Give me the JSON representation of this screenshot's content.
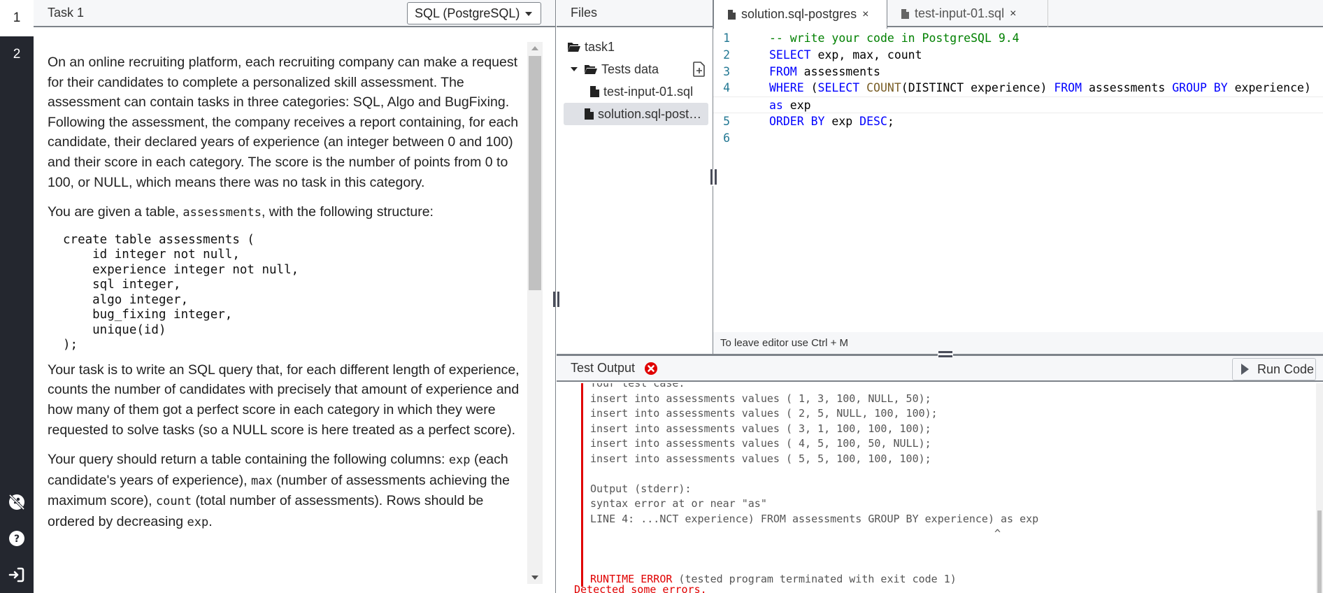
{
  "nav": {
    "tasks": [
      {
        "label": "1",
        "active": true
      },
      {
        "label": "2",
        "active": false
      }
    ],
    "bottom_icons": [
      "accessibility-off-icon",
      "help-icon",
      "sign-out-icon"
    ]
  },
  "task": {
    "title": "Task 1",
    "language": "SQL (PostgreSQL)",
    "para1": "On an online recruiting platform, each recruiting company can make a request for their candidates to complete a personalized skill assessment. The assessment can contain tasks in three categories: SQL, Algo and BugFixing. Following the assessment, the company receives a report containing, for each candidate, their declared years of experience (an integer between 0 and 100) and their score in each category. The score is the number of points from 0 to 100, or NULL, which means there was no task in this category.",
    "para2_before": "You are given a table, ",
    "para2_code": "assessments",
    "para2_after": ", with the following structure:",
    "schema": "create table assessments (\n    id integer not null,\n    experience integer not null,\n    sql integer,\n    algo integer,\n    bug_fixing integer,\n    unique(id)\n);",
    "para3": "Your task is to write an SQL query that, for each different length of experience, counts the number of candidates with precisely that amount of experience and how many of them got a perfect score in each category in which they were requested to solve tasks (so a NULL score is here treated as a perfect score).",
    "para4": {
      "t1": "Your query should return a table containing the following columns: ",
      "c1": "exp",
      "t2": " (each candidate's years of experience), ",
      "c2": "max",
      "t3": " (number of assessments achieving the maximum score), ",
      "c3": "count",
      "t4": " (total number of assessments). Rows should be ordered by decreasing ",
      "c4": "exp",
      "t5": "."
    }
  },
  "files": {
    "title": "Files",
    "root": "task1",
    "folder": "Tests data",
    "items": [
      "test-input-01.sql",
      "solution.sql-post…"
    ]
  },
  "editor": {
    "tabs": [
      {
        "label": "solution.sql-postgres",
        "close": "×"
      },
      {
        "label": "test-input-01.sql",
        "close": "×"
      }
    ],
    "lines": [
      {
        "n": "1",
        "tokens": [
          {
            "t": "-- write your code in PostgreSQL 9.4",
            "c": "cm"
          }
        ]
      },
      {
        "n": "2",
        "tokens": [
          {
            "t": "SELECT",
            "c": "kw"
          },
          {
            "t": " exp, max, count",
            "c": ""
          }
        ]
      },
      {
        "n": "3",
        "tokens": [
          {
            "t": "FROM",
            "c": "kw"
          },
          {
            "t": " assessments",
            "c": ""
          }
        ]
      },
      {
        "n": "4",
        "tokens": [
          {
            "t": "WHERE",
            "c": "kw"
          },
          {
            "t": " (",
            "c": ""
          },
          {
            "t": "SELECT",
            "c": "kw"
          },
          {
            "t": " ",
            "c": ""
          },
          {
            "t": "COUNT",
            "c": "fn"
          },
          {
            "t": "(DISTINCT experience) ",
            "c": ""
          },
          {
            "t": "FROM",
            "c": "kw"
          },
          {
            "t": " assessments ",
            "c": ""
          },
          {
            "t": "GROUP BY",
            "c": "kw"
          },
          {
            "t": " experience)",
            "c": ""
          }
        ]
      },
      {
        "n": "",
        "tokens": [
          {
            "t": "as",
            "c": "kw"
          },
          {
            "t": " exp",
            "c": ""
          }
        ]
      },
      {
        "n": "5",
        "tokens": [
          {
            "t": "ORDER BY",
            "c": "kw"
          },
          {
            "t": " exp ",
            "c": ""
          },
          {
            "t": "DESC",
            "c": "kw"
          },
          {
            "t": ";",
            "c": ""
          }
        ]
      },
      {
        "n": "6",
        "tokens": []
      }
    ],
    "footer": "To leave editor use Ctrl + M"
  },
  "output": {
    "title": "Test Output",
    "run_label": "Run Code",
    "lines": [
      "Your test case:",
      "insert into assessments values ( 1, 3, 100, NULL, 50);",
      "insert into assessments values ( 2, 5, NULL, 100, 100);",
      "insert into assessments values ( 3, 1, 100, 100, 100);",
      "insert into assessments values ( 4, 5, 100, 50, NULL);",
      "insert into assessments values ( 5, 5, 100, 100, 100);",
      "",
      "Output (stderr):",
      "syntax error at or near \"as\"",
      "LINE 4: ...NCT experience) FROM assessments GROUP BY experience) as exp",
      "                                                                ^",
      "",
      ""
    ],
    "runtime_error_label": "RUNTIME ERROR",
    "runtime_error_detail": " (tested program terminated with exit code 1)",
    "summary": "Detected some errors.",
    "colors": {
      "error": "#e00000"
    }
  }
}
